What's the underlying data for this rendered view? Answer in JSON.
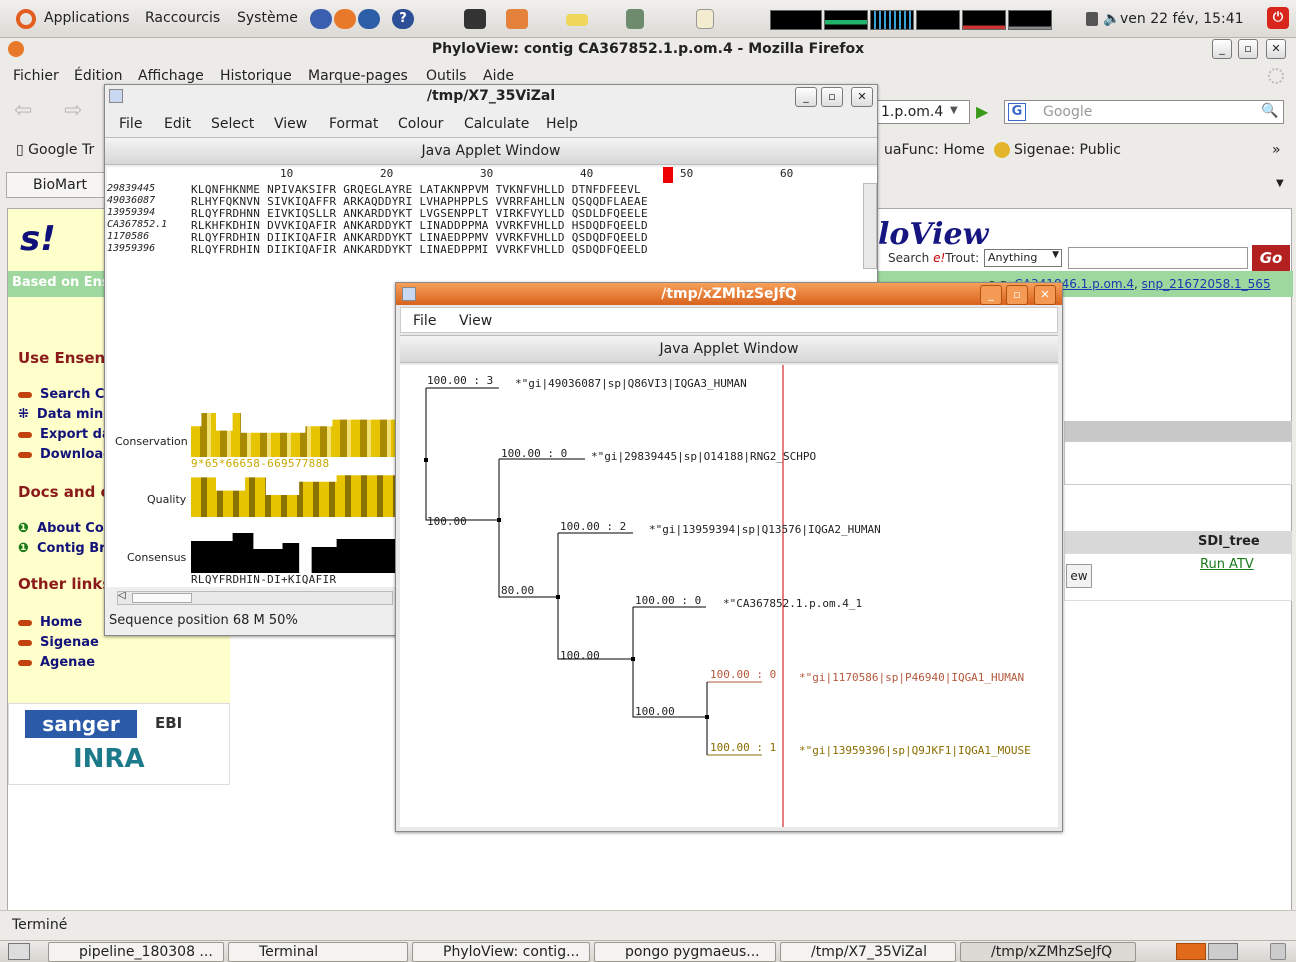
{
  "top_panel": {
    "menus": [
      "Applications",
      "Raccourcis",
      "Système"
    ],
    "clock": "ven 22 fév, 15:41"
  },
  "firefox": {
    "title": "PhyloView: contig CA367852.1.p.om.4 - Mozilla Firefox",
    "menu": [
      "Fichier",
      "Édition",
      "Affichage",
      "Historique",
      "Marque-pages",
      "Outils",
      "Aide"
    ],
    "url_tail": "1.p.om.4",
    "search_placeholder": "Google",
    "bookmarks": [
      "Google Tr",
      "uaFunc: Home",
      "Sigenae: Public"
    ],
    "tab": "BioMart",
    "status": "Terminé"
  },
  "page": {
    "green_bar": "Based on Ens",
    "search_label": "Search",
    "search_label_em": "e!",
    "search_label_rest": "Trout:",
    "search_select": "Anything",
    "go_button": "Go",
    "logo_text": "loView",
    "example_prefix": "e.g. ",
    "example_link1": "CA341846.1.p.om.4",
    "example_link2": "snp_21672058.1_565",
    "sidebar": {
      "use_heading": "Use Ensen",
      "use_links": [
        "Search Co",
        "Data minin",
        "Export dat",
        "Download"
      ],
      "docs_heading": "Docs and c",
      "docs_links": [
        "About Cor",
        "Contig Bro"
      ],
      "other_heading": "Other links",
      "other_links": [
        "Home",
        "Sigenae",
        "Agenae"
      ]
    },
    "logos": [
      "sanger",
      "EBI",
      "INRA"
    ],
    "sdi_header": "SDI_tree",
    "run_atv": "Run ATV",
    "view_button": "ew"
  },
  "align_window": {
    "title": "/tmp/X7_35ViZal",
    "menu": [
      "File",
      "Edit",
      "Select",
      "View",
      "Format",
      "Colour",
      "Calculate",
      "Help"
    ],
    "band": "Java Applet Window",
    "ruler": [
      "10",
      "20",
      "30",
      "40",
      "50",
      "60"
    ],
    "sequences": [
      {
        "name": "29839445",
        "seq": "KLQNFHKNME NPIVAKSIFR GRQEGLAYRE LATAKNPPVM TVKNFVHLLD DTNFDFEEVL"
      },
      {
        "name": "49036087",
        "seq": "RLHYFQKNVN SIVKIQAFFR ARKAQDDYRI LVHAPHPPLS VVRRFAHLLN QSQQDFLAEAE"
      },
      {
        "name": "13959394",
        "seq": "RLQYFRDHNN EIVKIQSLLR ANKARDDYKT LVGSENPPLT VIRKFVYLLD QSDLDFQEELE"
      },
      {
        "name": "CA367852.1",
        "seq": "RLKHFKDHIN DVVKIQAFIR ANKARDDYKT LINADDPPMA VVRKFVHLLD HSDQDFQEELD"
      },
      {
        "name": "1170586",
        "seq": "RLQYFRDHIN DIIKIQAFIR ANKARDDYKT LINAEDPPMV VVRKFVHLLD QSDQDFQEELD"
      },
      {
        "name": "13959396",
        "seq": "RLQYFRDHIN DIIKIQAFIR ANKARDDYKT LINAEDPPMI VVRKFVHLLD QSDQDFQEELD"
      }
    ],
    "tracks": [
      "Conservation",
      "Quality",
      "Consensus"
    ],
    "conservation_digits": "9*65*66658-669577888",
    "consensus_text": "RLQYFRDHIN-DI+KIQAFIR",
    "status": "Sequence position 68  M 50%"
  },
  "tree_window": {
    "title": "/tmp/xZMhzSeJfQ",
    "menu": [
      "File",
      "View"
    ],
    "band": "Java Applet Window",
    "branches": [
      "100.00 : 3",
      "100.00 : 0",
      "100.00 : 2",
      "100.00 : 0",
      "100.00 : 0",
      "100.00 : 1"
    ],
    "internal": [
      "100.00",
      "80.00",
      "100.00",
      "100.00"
    ],
    "leaves": [
      "*\"gi|49036087|sp|Q86VI3|IQGA3_HUMAN",
      "*\"gi|29839445|sp|O14188|RNG2_SCHPO",
      "*\"gi|13959394|sp|Q13576|IQGA2_HUMAN",
      "*\"CA367852.1.p.om.4_1",
      "*\"gi|1170586|sp|P46940|IQGA1_HUMAN",
      "*\"gi|13959396|sp|Q9JKF1|IQGA1_MOUSE"
    ],
    "colors": {
      "leaf5": "#b4583c",
      "leaf6": "#8a6d00",
      "cursor": "#cc0000"
    }
  },
  "taskbar": [
    "pipeline_180308 ...",
    "Terminal",
    "PhyloView: contig...",
    "pongo pygmaeus...",
    "/tmp/X7_35ViZal",
    "/tmp/xZMhzSeJfQ"
  ]
}
